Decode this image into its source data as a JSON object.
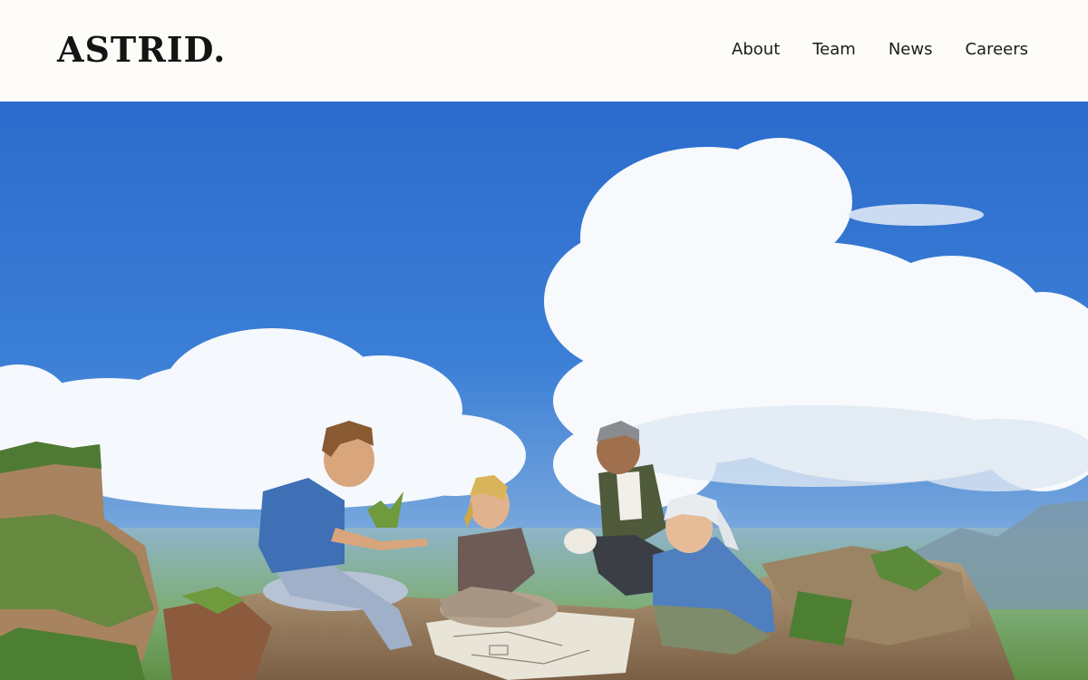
{
  "header": {
    "logo_text": "ASTRID.",
    "nav": [
      {
        "label": "About"
      },
      {
        "label": "Team"
      },
      {
        "label": "News"
      },
      {
        "label": "Careers"
      }
    ]
  },
  "hero": {
    "colors": {
      "sky_top": "#2d6ecf",
      "sky_bottom": "#8fb7de",
      "cloud": "#ffffff",
      "rock": "#a99173",
      "grass": "#6f9a3e"
    }
  }
}
